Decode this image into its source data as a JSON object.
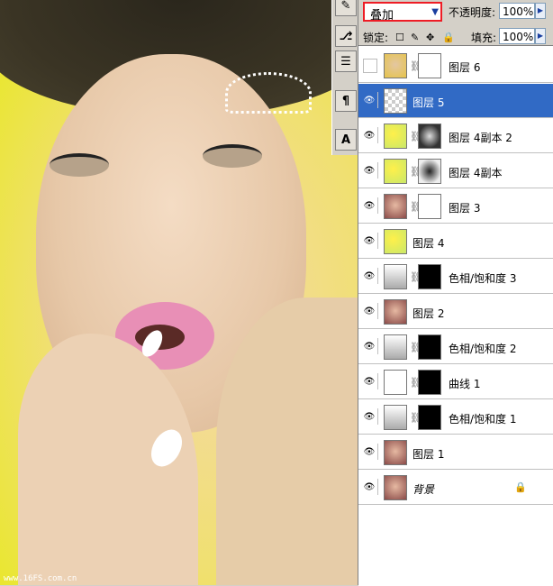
{
  "canvas": {
    "watermark": "www.16FS.com.cn"
  },
  "tools": [
    {
      "icon": "brush-icon",
      "glyph": "✎"
    },
    {
      "icon": "history-icon",
      "glyph": "⎇"
    },
    {
      "icon": "channels-icon",
      "glyph": "☰"
    },
    {
      "icon": "paragraph-icon",
      "glyph": "¶"
    },
    {
      "icon": "character-icon",
      "glyph": "A"
    }
  ],
  "panel": {
    "blend_mode": "叠加",
    "opacity_label": "不透明度:",
    "opacity_value": "100%",
    "lock_label": "锁定:",
    "fill_label": "填充:",
    "fill_value": "100%",
    "layers": [
      {
        "name": "图层 6",
        "visible": false,
        "thumb": "faceyel",
        "mask": "white",
        "selected": false
      },
      {
        "name": "图层 5",
        "visible": true,
        "thumb": "check",
        "mask": null,
        "selected": true
      },
      {
        "name": "图层 4副本 2",
        "visible": true,
        "thumb": "yellow",
        "mask": "softblack",
        "selected": false
      },
      {
        "name": "图层 4副本",
        "visible": true,
        "thumb": "yellow",
        "mask": "softwhite",
        "selected": false
      },
      {
        "name": "图层 3",
        "visible": true,
        "thumb": "face",
        "mask": "white",
        "selected": false
      },
      {
        "name": "图层 4",
        "visible": true,
        "thumb": "yellow",
        "mask": null,
        "selected": false
      },
      {
        "name": "色相/饱和度 3",
        "visible": true,
        "thumb": "adj",
        "mask": "black",
        "selected": false
      },
      {
        "name": "图层 2",
        "visible": true,
        "thumb": "face",
        "mask": null,
        "selected": false
      },
      {
        "name": "色相/饱和度 2",
        "visible": true,
        "thumb": "adj",
        "mask": "black",
        "selected": false
      },
      {
        "name": "曲线 1",
        "visible": true,
        "thumb": "curve",
        "mask": "black",
        "selected": false
      },
      {
        "name": "色相/饱和度 1",
        "visible": true,
        "thumb": "adj",
        "mask": "black",
        "selected": false
      },
      {
        "name": "图层 1",
        "visible": true,
        "thumb": "face",
        "mask": null,
        "selected": false
      },
      {
        "name": "背景",
        "visible": true,
        "thumb": "face",
        "mask": null,
        "selected": false,
        "locked": true,
        "italic": true
      }
    ]
  }
}
